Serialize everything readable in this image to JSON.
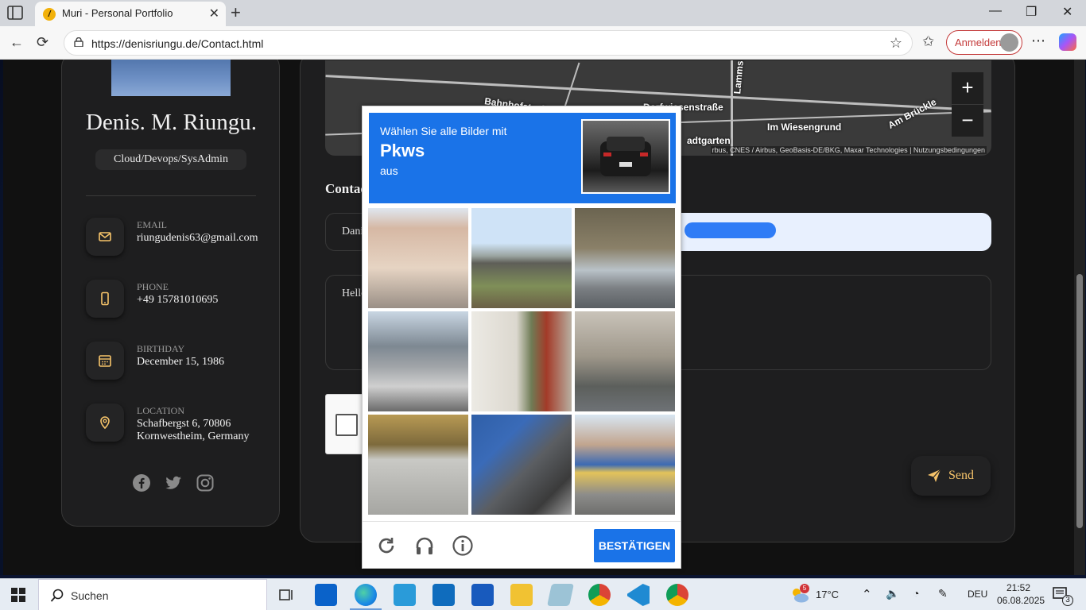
{
  "browser": {
    "tab_title": "Muri - Personal Portfolio",
    "url": "https://denisriungu.de/Contact.html",
    "login_label": "Anmelden"
  },
  "profile": {
    "name": "Denis. M. Riungu.",
    "role": "Cloud/Devops/SysAdmin",
    "contacts": [
      {
        "label": "Email",
        "value": "riungudenis63@gmail.com",
        "icon": "mail-icon"
      },
      {
        "label": "Phone",
        "value": "+49 15781010695",
        "icon": "phone-icon"
      },
      {
        "label": "Birthday",
        "value": "December 15, 1986",
        "icon": "calendar-icon"
      },
      {
        "label": "Location",
        "value": "Schafbergst 6, 70806 Kornwestheim, Germany",
        "icon": "location-icon"
      }
    ],
    "socials": [
      "facebook-icon",
      "twitter-icon",
      "instagram-icon"
    ]
  },
  "map": {
    "labels": [
      "Bahnhofstraße",
      "Dorfwiesenstraße",
      "Im Wiesengrund",
      "Am Brückle",
      "Lammstr",
      "adtgarten"
    ],
    "attribution": "rbus, CNES / Airbus, GeoBasis-DE/BKG, Maxar Technologies",
    "terms": "Nutzungsbedingungen",
    "zoom_in": "+",
    "zoom_out": "−"
  },
  "form": {
    "heading": "Contac",
    "name_value": "Dani",
    "message_value": "Hello",
    "send_label": "Send"
  },
  "captcha": {
    "line1": "Wählen Sie alle Bilder mit",
    "keyword": "Pkws",
    "line3": "aus",
    "verify_label": "BESTÄTIGEN",
    "tiles": [
      "building-balconies",
      "empty-lot-street",
      "parked-cars-street",
      "street-motorbike",
      "house-stairs",
      "brick-building",
      "concrete-wall",
      "bus-and-car",
      "narrow-street-van"
    ]
  },
  "taskbar": {
    "search_placeholder": "Suchen",
    "temperature": "17°C",
    "weather_badge": "5",
    "language": "DEU",
    "time": "21:52",
    "date": "06.08.2025",
    "notification_count": "3"
  },
  "colors": {
    "captcha_blue": "#1a73e8",
    "send_text": "#f7c46a",
    "panel_bg": "#1e1e1f"
  }
}
